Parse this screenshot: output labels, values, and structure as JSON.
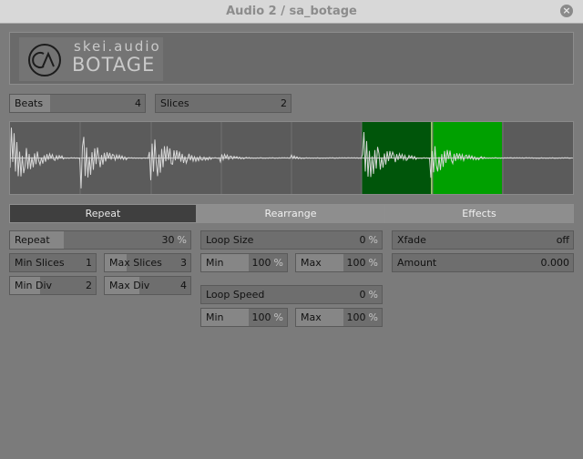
{
  "window": {
    "title": "Audio 2 / sa_botage",
    "close_glyph": "×"
  },
  "logo": {
    "small": "skei.audio",
    "big": "BOTAGE"
  },
  "beats": {
    "label": "Beats",
    "value": "4",
    "fill": 0.3
  },
  "slices": {
    "label": "Slices",
    "value": "2",
    "fill": 0.0
  },
  "waveform": {
    "beat_count": 4,
    "slice_count": 2,
    "highlight_color": "#00a000",
    "highlight_dark_color": "#005a00"
  },
  "tabs": [
    {
      "label": "Repeat",
      "active": true
    },
    {
      "label": "Rearrange",
      "active": false
    },
    {
      "label": "Effects",
      "active": false
    }
  ],
  "repeat": {
    "label": "Repeat",
    "value": "30",
    "unit": "%",
    "fill": 0.3
  },
  "min_slices": {
    "label": "Min Slices",
    "value": "1",
    "fill": 0.0
  },
  "max_slices": {
    "label": "Max Slices",
    "value": "3",
    "fill": 0.25
  },
  "min_div": {
    "label": "Min Div",
    "value": "2",
    "fill": 0.35
  },
  "max_div": {
    "label": "Max Div",
    "value": "4",
    "fill": 0.4
  },
  "loop_size": {
    "label": "Loop Size",
    "value": "0",
    "unit": "%",
    "fill": 0.0,
    "min": {
      "label": "Min",
      "value": "100",
      "unit": "%",
      "fill": 0.55
    },
    "max": {
      "label": "Max",
      "value": "100",
      "unit": "%",
      "fill": 0.55
    }
  },
  "loop_speed": {
    "label": "Loop Speed",
    "value": "0",
    "unit": "%",
    "fill": 0.0,
    "min": {
      "label": "Min",
      "value": "100",
      "unit": "%",
      "fill": 0.55
    },
    "max": {
      "label": "Max",
      "value": "100",
      "unit": "%",
      "fill": 0.55
    }
  },
  "xfade": {
    "label": "Xfade",
    "value": "off",
    "fill": 0.0
  },
  "amount": {
    "label": "Amount",
    "value": "0.000",
    "fill": 0.0
  }
}
